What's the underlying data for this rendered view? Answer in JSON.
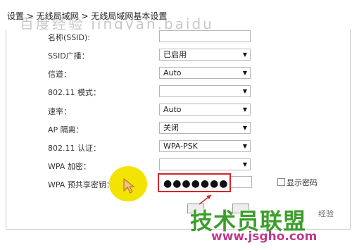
{
  "window": {
    "title": "设置 > 无线局域网 > 无线局域网基本设置",
    "watermark_top": "百度经验 jingyan.baidu"
  },
  "form": {
    "rows": [
      {
        "label": "名称(SSID):",
        "value": "",
        "kind": "text"
      },
      {
        "label": "SSID广播：",
        "value": "已启用",
        "kind": "select"
      },
      {
        "label": "信道：",
        "value": "Auto",
        "kind": "select"
      },
      {
        "label": "802.11 模式：",
        "value": "",
        "kind": "select"
      },
      {
        "label": "速率：",
        "value": "Auto",
        "kind": "select"
      },
      {
        "label": "AP 隔离：",
        "value": "关闭",
        "kind": "select"
      },
      {
        "label": "802.11 认证：",
        "value": "WPA-PSK",
        "kind": "select"
      },
      {
        "label": "WPA 加密：",
        "value": "",
        "kind": "select"
      }
    ],
    "psk": {
      "label": "WPA 预共享密钥：",
      "value": "●●●●●●●"
    },
    "show_password": {
      "label": "显示密码",
      "checked": false
    }
  },
  "watermark": {
    "main": "技术员联盟",
    "url": "www.jsgho.com",
    "ext": "经验"
  },
  "colors": {
    "highlight": "#d0262c",
    "cursor": "#f2e400",
    "brand_green": "#3c9e2a",
    "brand_pink": "#c23a8a"
  }
}
